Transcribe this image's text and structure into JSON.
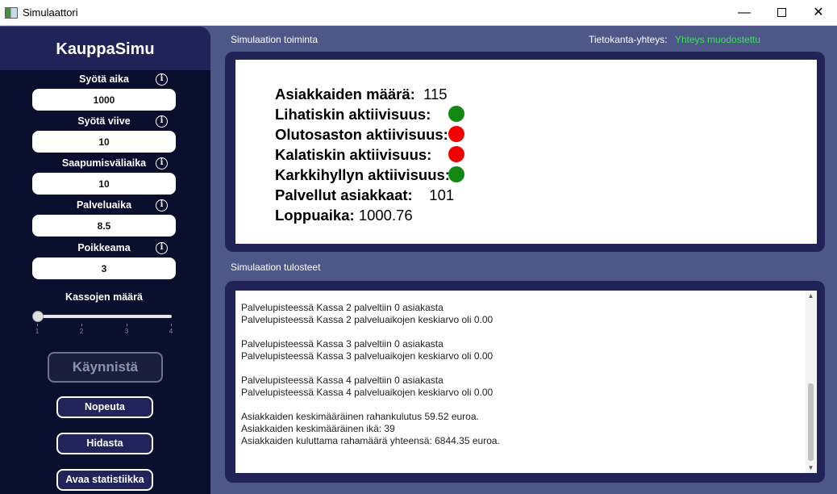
{
  "window": {
    "title": "Simulaattori",
    "minimize_glyph": "—",
    "close_glyph": "✕"
  },
  "sidebar": {
    "brand": "KauppaSimu",
    "fields": [
      {
        "label": "Syötä aika",
        "value": "1000"
      },
      {
        "label": "Syötä viive",
        "value": "10"
      },
      {
        "label": "Saapumisväliaika",
        "value": "10"
      },
      {
        "label": "Palveluaika",
        "value": "8.5"
      },
      {
        "label": "Poikkeama",
        "value": "3"
      }
    ],
    "info_glyph": "i",
    "slider": {
      "label": "Kassojen määrä",
      "ticks": [
        "1",
        "2",
        "3",
        "4"
      ],
      "value": 1
    },
    "start_button": "Käynnistä",
    "speed_up_button": "Nopeuta",
    "slow_down_button": "Hidasta",
    "statistics_button": "Avaa statistiikka"
  },
  "main": {
    "operation_label": "Simulaation toiminta",
    "db_label": "Tietokanta-yhteys:",
    "db_value": "Yhteys muodostettu",
    "stats": {
      "customers_key": "Asiakkaiden määrä:",
      "customers_val": "115",
      "meat_key": "Lihatiskin aktiivisuus:",
      "beer_key": "Olutosaston aktiivisuus:",
      "fish_key": "Kalatiskin aktiivisuus:",
      "candy_key": "Karkkihyllyn aktiivisuus:",
      "served_key": "Palvellut asiakkaat:",
      "served_val": "101",
      "end_key": "Loppuaika:",
      "end_val": "1000.76"
    },
    "activity_colors": {
      "meat": "#128a12",
      "beer": "#f20000",
      "fish": "#f20000",
      "candy": "#128a12"
    },
    "output_label": "Simulaation tulosteet",
    "log_lines": [
      "Palvelupisteessä Kassa 2 palveltiin 0 asiakasta",
      "Palvelupisteessä Kassa 2 palveluaikojen keskiarvo oli 0.00",
      "",
      "Palvelupisteessä Kassa 3 palveltiin 0 asiakasta",
      "Palvelupisteessä Kassa 3 palveluaikojen keskiarvo oli 0.00",
      "",
      "Palvelupisteessä Kassa 4 palveltiin 0 asiakasta",
      "Palvelupisteessä Kassa 4 palveluaikojen keskiarvo oli 0.00",
      "",
      "Asiakkaiden keskimääräinen rahankulutus 59.52 euroa.",
      "Asiakkaiden keskimääräinen ikä: 39",
      "Asiakkaiden kuluttama rahamäärä yhteensä: 6844.35 euroa."
    ],
    "scroll_up_glyph": "▲",
    "scroll_down_glyph": "▼"
  }
}
